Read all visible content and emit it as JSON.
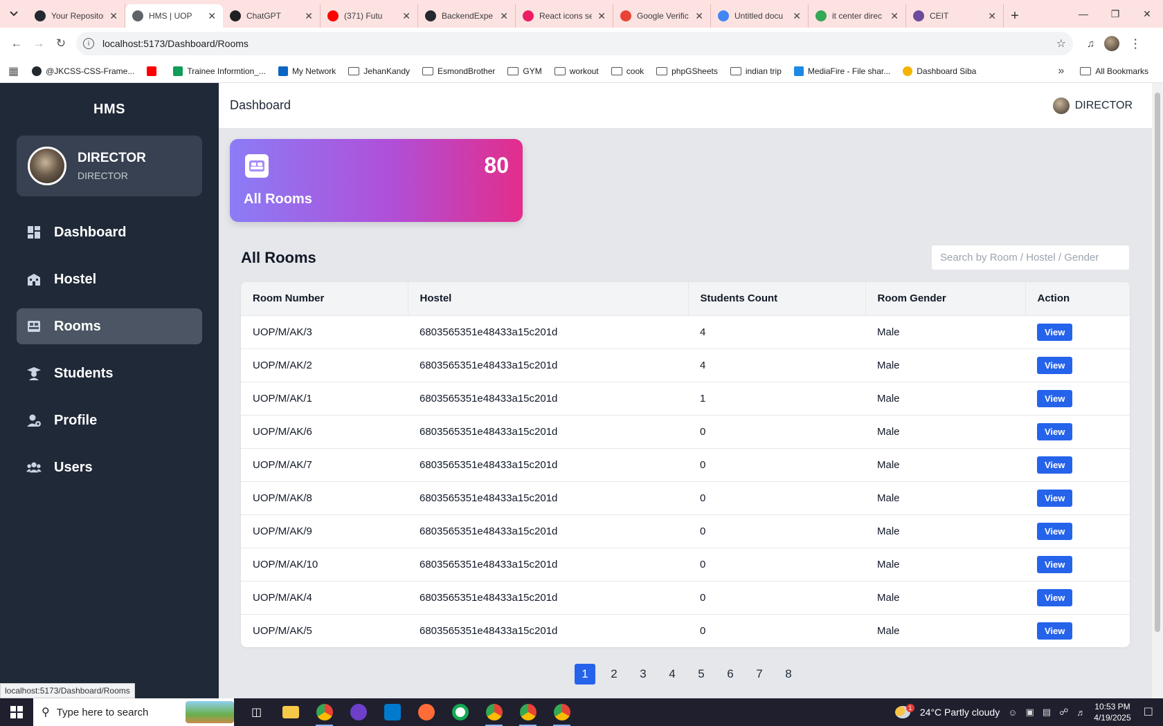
{
  "browser": {
    "tabs": [
      {
        "label": "Your Repositor",
        "color": "#24292f",
        "active": false
      },
      {
        "label": "HMS | UOP",
        "color": "#5f6368",
        "active": true
      },
      {
        "label": "ChatGPT",
        "color": "#202123",
        "active": false
      },
      {
        "label": "(371) Futu",
        "color": "#ff0000",
        "active": false
      },
      {
        "label": "BackendExpe",
        "color": "#24292f",
        "active": false
      },
      {
        "label": "React icons se",
        "color": "#e91e63",
        "active": false
      },
      {
        "label": "Google Verific",
        "color": "#ea4335",
        "active": false
      },
      {
        "label": "Untitled docu",
        "color": "#4285f4",
        "active": false
      },
      {
        "label": "it center direc",
        "color": "#34a853",
        "active": false
      },
      {
        "label": "CEIT",
        "color": "#6d4c9b",
        "active": false
      }
    ],
    "url": "localhost:5173/Dashboard/Rooms",
    "bookmarks": [
      {
        "label": "@JKCSS-CSS-Frame...",
        "kind": "github"
      },
      {
        "label": "",
        "kind": "youtube"
      },
      {
        "label": "Trainee Informtion_...",
        "kind": "sheets"
      },
      {
        "label": "My Network",
        "kind": "linkedin"
      },
      {
        "label": "JehanKandy",
        "kind": "folder"
      },
      {
        "label": "EsmondBrother",
        "kind": "folder"
      },
      {
        "label": "GYM",
        "kind": "folder"
      },
      {
        "label": "workout",
        "kind": "folder"
      },
      {
        "label": "cook",
        "kind": "folder"
      },
      {
        "label": "phpGSheets",
        "kind": "folder"
      },
      {
        "label": "indian trip",
        "kind": "folder"
      },
      {
        "label": "MediaFire - File shar...",
        "kind": "mediafire"
      },
      {
        "label": "Dashboard Siba",
        "kind": "sun"
      }
    ],
    "all_bookmarks": "All Bookmarks",
    "status_url": "localhost:5173/Dashboard/Rooms"
  },
  "app": {
    "brand": "HMS",
    "user": {
      "name": "DIRECTOR",
      "role": "DIRECTOR"
    },
    "nav": [
      {
        "label": "Dashboard",
        "icon": "dashboard-icon",
        "active": false
      },
      {
        "label": "Hostel",
        "icon": "hostel-icon",
        "active": false
      },
      {
        "label": "Rooms",
        "icon": "rooms-icon",
        "active": true
      },
      {
        "label": "Students",
        "icon": "students-icon",
        "active": false
      },
      {
        "label": "Profile",
        "icon": "profile-icon",
        "active": false
      },
      {
        "label": "Users",
        "icon": "users-icon",
        "active": false
      }
    ],
    "page_title": "Dashboard",
    "top_user": "DIRECTOR",
    "stat": {
      "count": "80",
      "label": "All Rooms"
    },
    "section_title": "All Rooms",
    "search_placeholder": "Search by Room / Hostel / Gender",
    "table": {
      "headers": [
        "Room Number",
        "Hostel",
        "Students Count",
        "Room Gender",
        "Action"
      ],
      "rows": [
        [
          "UOP/M/AK/3",
          "6803565351e48433a15c201d",
          "4",
          "Male",
          "View"
        ],
        [
          "UOP/M/AK/2",
          "6803565351e48433a15c201d",
          "4",
          "Male",
          "View"
        ],
        [
          "UOP/M/AK/1",
          "6803565351e48433a15c201d",
          "1",
          "Male",
          "View"
        ],
        [
          "UOP/M/AK/6",
          "6803565351e48433a15c201d",
          "0",
          "Male",
          "View"
        ],
        [
          "UOP/M/AK/7",
          "6803565351e48433a15c201d",
          "0",
          "Male",
          "View"
        ],
        [
          "UOP/M/AK/8",
          "6803565351e48433a15c201d",
          "0",
          "Male",
          "View"
        ],
        [
          "UOP/M/AK/9",
          "6803565351e48433a15c201d",
          "0",
          "Male",
          "View"
        ],
        [
          "UOP/M/AK/10",
          "6803565351e48433a15c201d",
          "0",
          "Male",
          "View"
        ],
        [
          "UOP/M/AK/4",
          "6803565351e48433a15c201d",
          "0",
          "Male",
          "View"
        ],
        [
          "UOP/M/AK/5",
          "6803565351e48433a15c201d",
          "0",
          "Male",
          "View"
        ]
      ]
    },
    "pagination": {
      "pages": [
        "1",
        "2",
        "3",
        "4",
        "5",
        "6",
        "7",
        "8"
      ],
      "current": "1"
    }
  },
  "taskbar": {
    "search_placeholder": "Type here to search",
    "weather": "24°C  Partly cloudy",
    "time": "10:53 PM",
    "date": "4/19/2025",
    "notification_count": "1",
    "colors": {
      "chrome": "#4285f4",
      "github": "#6e40c9",
      "vscode": "#007acc",
      "postman": "#ff6c37",
      "mongodb": "#13aa52",
      "explorer": "#f7c948"
    }
  }
}
